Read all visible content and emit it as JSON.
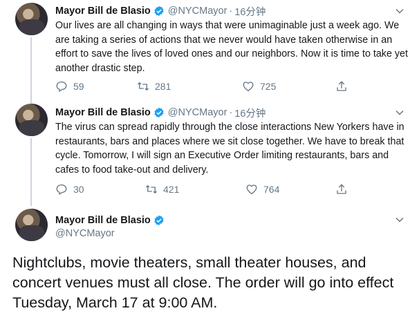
{
  "tweets": [
    {
      "name": "Mayor Bill de Blasio",
      "handle": "@NYCMayor",
      "dot": "·",
      "time": "16分钟",
      "text": "Our lives are all changing in ways that were unimaginable just a week ago. We are taking a series of actions that we never would have taken otherwise in an effort to save the lives of loved ones and our neighbors. Now it is time to take yet another drastic step.",
      "replies": "59",
      "retweets": "281",
      "likes": "725"
    },
    {
      "name": "Mayor Bill de Blasio",
      "handle": "@NYCMayor",
      "dot": "·",
      "time": "16分钟",
      "text": "The virus can spread rapidly through the close interactions New Yorkers have in restaurants, bars and places where we sit close together. We have to break that cycle. Tomorrow, I will sign an Executive Order limiting restaurants, bars and cafes to food take-out and delivery.",
      "replies": "30",
      "retweets": "421",
      "likes": "764"
    }
  ],
  "focused": {
    "name": "Mayor Bill de Blasio",
    "handle": "@NYCMayor",
    "text": "Nightclubs, movie theaters, small theater houses, and concert venues must all close. The order will go into effect Tuesday, March 17 at 9:00 AM."
  },
  "colors": {
    "verified": "#1da1f2",
    "secondary": "#657786",
    "line": "#ccd6dd"
  },
  "icons": [
    "verified-badge-icon",
    "caret-down-icon",
    "reply-icon",
    "retweet-icon",
    "like-icon",
    "share-icon"
  ]
}
